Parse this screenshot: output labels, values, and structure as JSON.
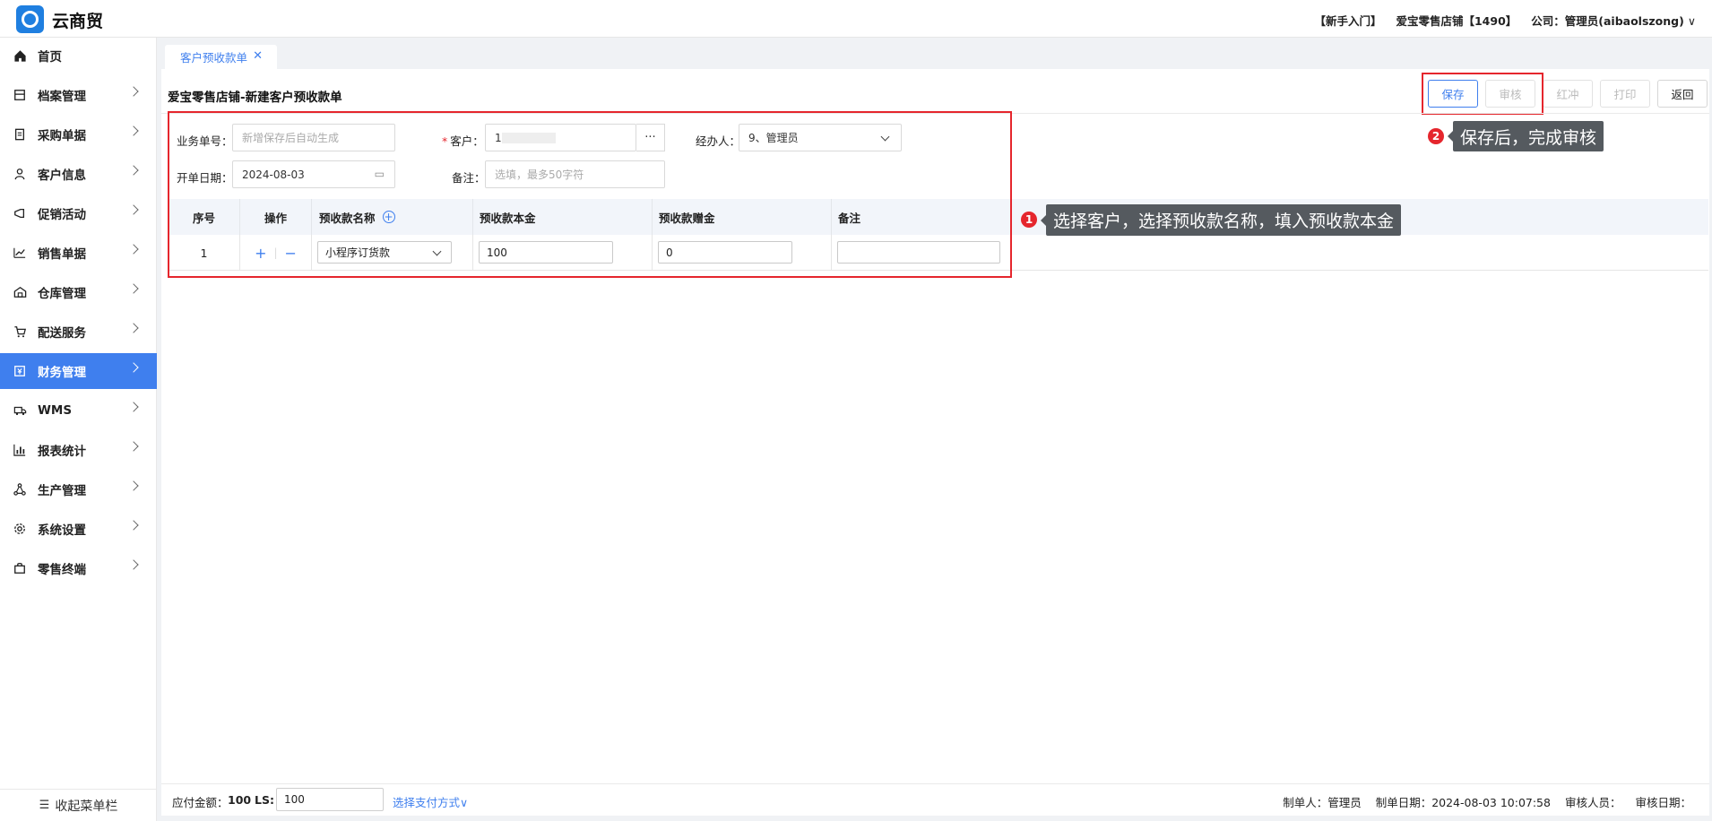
{
  "header": {
    "brand": "云商贸",
    "newbie": "【新手入门】",
    "store": "爱宝零售店铺【1490】",
    "company": "公司：管理员(aibaolszong)",
    "caret": "∨"
  },
  "sidebar": {
    "items": [
      {
        "label": "首页",
        "icon": "home-icon"
      },
      {
        "label": "档案管理",
        "icon": "archive-icon"
      },
      {
        "label": "采购单据",
        "icon": "purchase-doc-icon"
      },
      {
        "label": "客户信息",
        "icon": "user-icon"
      },
      {
        "label": "促销活动",
        "icon": "megaphone-icon"
      },
      {
        "label": "销售单据",
        "icon": "chart-line-icon"
      },
      {
        "label": "仓库管理",
        "icon": "warehouse-icon"
      },
      {
        "label": "配送服务",
        "icon": "cart-icon"
      },
      {
        "label": "财务管理",
        "icon": "finance-icon"
      },
      {
        "label": "WMS",
        "icon": "truck-icon"
      },
      {
        "label": "报表统计",
        "icon": "bar-chart-icon"
      },
      {
        "label": "生产管理",
        "icon": "network-icon"
      },
      {
        "label": "系统设置",
        "icon": "gear-icon"
      },
      {
        "label": "零售终端",
        "icon": "bag-icon"
      }
    ],
    "active": "财务管理",
    "collapse_label": "收起菜单栏",
    "collapse_icon": "☰"
  },
  "tabs": [
    {
      "label": "客户预收款单",
      "close": "✕"
    }
  ],
  "page": {
    "title": "爱宝零售店铺-新建客户预收款单",
    "buttons": {
      "save": "保存",
      "audit": "审核",
      "red": "红冲",
      "print": "打印",
      "back": "返回"
    }
  },
  "form": {
    "order_no_label": "业务单号：",
    "order_no_placeholder": "新增保存后自动生成",
    "customer_label": "客户：",
    "customer_required": "*",
    "customer_value": "17            5",
    "customer_dots": "···",
    "handler_label": "经办人：",
    "handler_value": "9、管理员",
    "date_label": "开单日期：",
    "date_value": "2024-08-03",
    "date_icon": "▭",
    "remark_label": "备注：",
    "remark_placeholder": "选填，最多50字符"
  },
  "table": {
    "headers": {
      "seq": "序号",
      "op": "操作",
      "name": "预收款名称",
      "principal": "预收款本金",
      "gift": "预收款赠金",
      "remark": "备注"
    },
    "add_icon": "+",
    "rows": [
      {
        "seq": "1",
        "add": "+",
        "sep": "|",
        "remove": "−",
        "name": "小程序订货款",
        "principal": "100",
        "gift": "0",
        "remark": ""
      }
    ]
  },
  "annotations": [
    {
      "num": "1",
      "text": "选择客户，选择预收款名称，填入预收款本金"
    },
    {
      "num": "2",
      "text": "保存后，完成审核"
    }
  ],
  "footer": {
    "payable_label": "应付金额：",
    "payable_value": "100",
    "ls_label": "LS:",
    "ls_value": "100",
    "pay_link": "选择支付方式∨",
    "maker": "制单人：管理员",
    "make_date": "制单日期：2024-08-03 10:07:58",
    "auditor": "审核人员：",
    "audit_date": "审核日期："
  },
  "colors": {
    "accent": "#3f7fee",
    "annotation_red": "#e5262d",
    "tip_bg": "#555a5f"
  }
}
